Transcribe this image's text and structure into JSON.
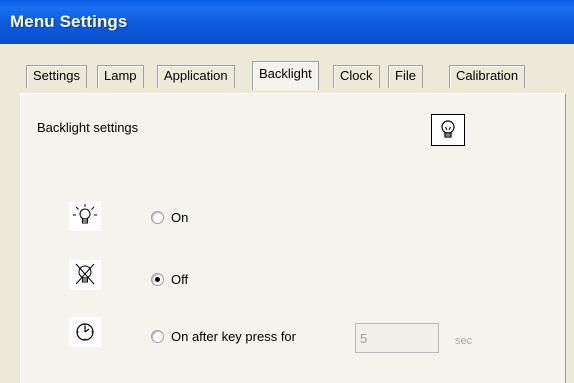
{
  "window": {
    "title": "Menu Settings"
  },
  "tabs": [
    {
      "label": "Settings",
      "active": false
    },
    {
      "label": "Lamp",
      "active": false
    },
    {
      "label": "Application",
      "active": false
    },
    {
      "label": "Backlight",
      "active": true
    },
    {
      "label": "Clock",
      "active": false
    },
    {
      "label": "File",
      "active": false
    },
    {
      "label": "Calibration",
      "active": false
    }
  ],
  "backlight": {
    "section_label": "Backlight settings",
    "options": [
      {
        "label": "On",
        "icon": "bulb-on-icon",
        "checked": false
      },
      {
        "label": "Off",
        "icon": "bulb-off-icon",
        "checked": true
      },
      {
        "label": "On after key press for",
        "icon": "timer-icon",
        "checked": false
      }
    ],
    "delay_value": "5",
    "delay_unit": "sec"
  },
  "colors": {
    "title_bar": "#0a59dc",
    "face": "#ece9d8",
    "panel": "#f4f3ee"
  }
}
